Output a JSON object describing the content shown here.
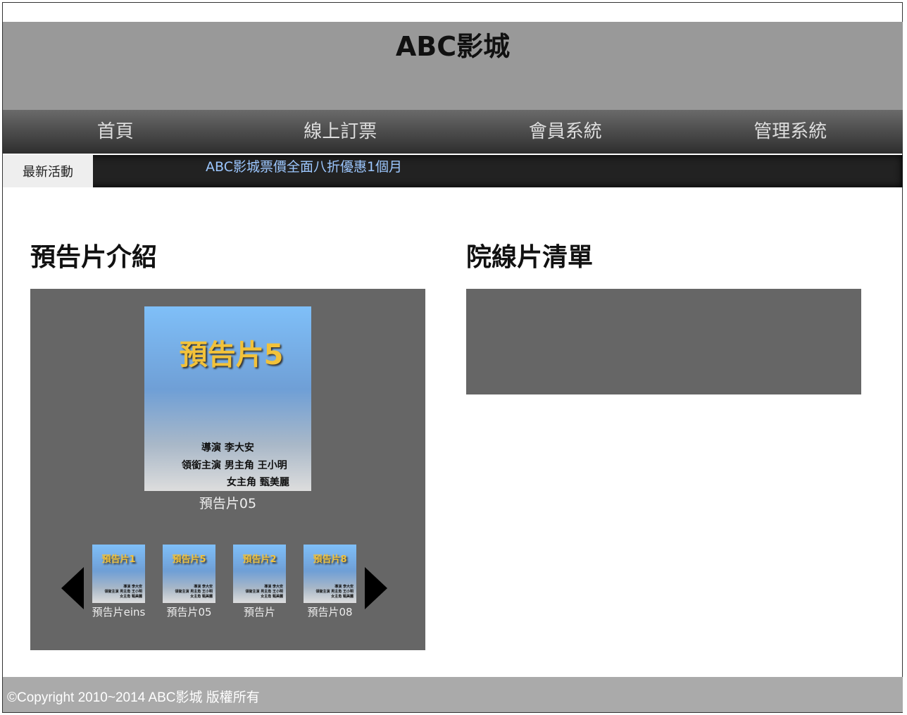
{
  "site": {
    "title": "ABC影城"
  },
  "nav": {
    "items": [
      "首頁",
      "線上訂票",
      "會員系統",
      "管理系統"
    ]
  },
  "ticker": {
    "label": "最新活動",
    "text": "ABC影城票價全面八折優惠1個月"
  },
  "trailers": {
    "title": "預告片介紹",
    "featured": {
      "poster_title": "預告片5",
      "director": "導演 李大安",
      "cast_line1": "領銜主演 男主角 王小明",
      "cast_line2": "女主角 甄美麗",
      "caption": "預告片05"
    },
    "thumbnails": [
      {
        "poster_title": "預告片1",
        "caption": "預告片eins"
      },
      {
        "poster_title": "預告片5",
        "caption": "預告片05"
      },
      {
        "poster_title": "預告片2",
        "caption": "預告片"
      },
      {
        "poster_title": "預告片8",
        "caption": "預告片08"
      }
    ],
    "thumb_credits": [
      "導演 李大安",
      "領銜主演 男主角 王小明",
      "女主角 甄美麗"
    ]
  },
  "now_showing": {
    "title": "院線片清單"
  },
  "footer": {
    "text": "©Copyright 2010~2014 ABC影城 版權所有"
  },
  "colors": {
    "header_bg": "#999999",
    "nav_bg": "#2e2e2e",
    "panel_bg": "#666666",
    "ticker_text": "#9cc7ff",
    "poster_title": "#f2c23a"
  }
}
